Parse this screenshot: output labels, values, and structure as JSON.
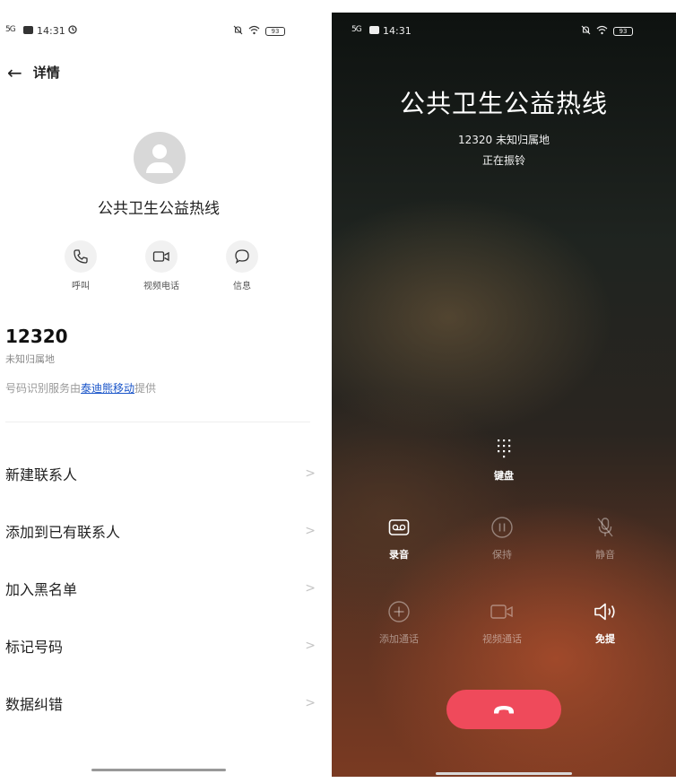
{
  "left": {
    "status": {
      "signal": "5G",
      "time": "14:31",
      "battery": "93"
    },
    "header": {
      "back_symbol": "←",
      "title": "详情"
    },
    "contact_name": "公共卫生公益热线",
    "actions": [
      {
        "label": "呼叫",
        "icon": "phone-icon"
      },
      {
        "label": "视频电话",
        "icon": "video-icon"
      },
      {
        "label": "信息",
        "icon": "message-icon"
      }
    ],
    "number": "12320",
    "location": "未知归属地",
    "provider": {
      "prefix": "号码识别服务由",
      "link": "泰迪熊移动",
      "suffix": "提供"
    },
    "menu": [
      {
        "label": "新建联系人"
      },
      {
        "label": "添加到已有联系人"
      },
      {
        "label": "加入黑名单"
      },
      {
        "label": "标记号码"
      },
      {
        "label": "数据纠错"
      }
    ],
    "chevron": ">"
  },
  "right": {
    "status": {
      "signal": "5G",
      "time": "14:31",
      "battery": "93"
    },
    "call_name": "公共卫生公益热线",
    "call_sub": "12320 未知归属地",
    "call_status": "正在振铃",
    "keypad_label": "键盘",
    "controls": [
      {
        "label": "录音",
        "icon": "record-icon",
        "enabled": true
      },
      {
        "label": "保持",
        "icon": "pause-icon",
        "enabled": false
      },
      {
        "label": "静音",
        "icon": "mute-icon",
        "enabled": false
      },
      {
        "label": "添加通话",
        "icon": "add-call-icon",
        "enabled": false
      },
      {
        "label": "视频通话",
        "icon": "video-call-icon",
        "enabled": false
      },
      {
        "label": "免提",
        "icon": "speaker-icon",
        "enabled": true
      }
    ],
    "colors": {
      "hangup": "#ef4a5b",
      "link": "#1a55c9"
    }
  }
}
